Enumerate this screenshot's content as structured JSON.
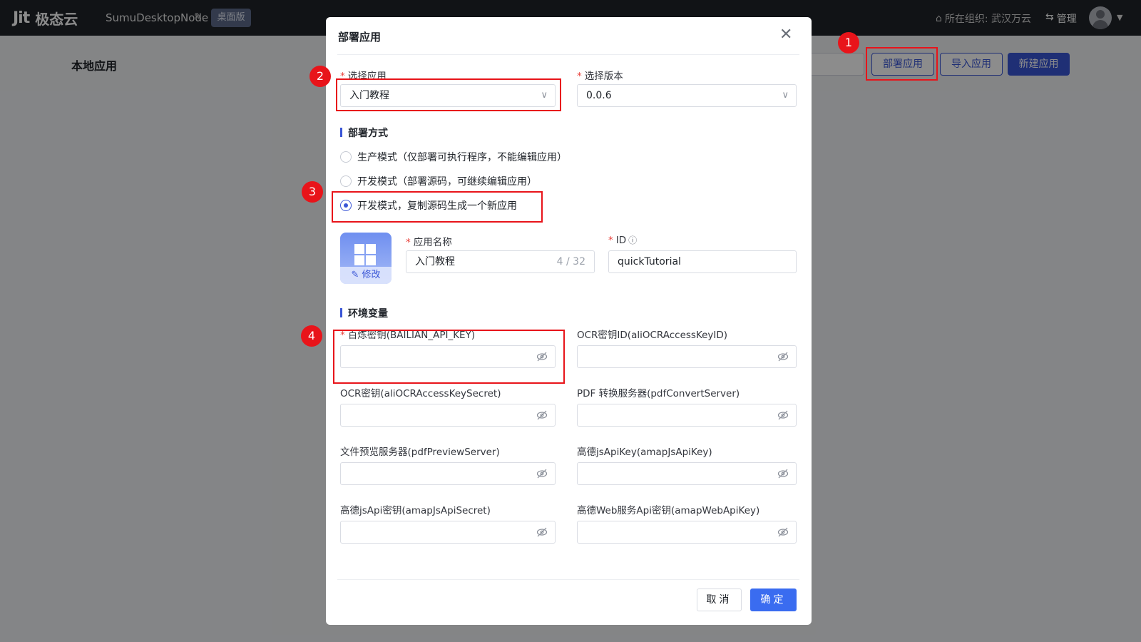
{
  "topbar": {
    "logo_mark": "Jit",
    "logo_text": "极态云",
    "node_name": "SumuDesktopNode",
    "badge": "桌面版",
    "org_label": "所在组织: 武汉万云",
    "manage": "管理"
  },
  "page": {
    "title": "本地应用",
    "buttons": {
      "deploy": "部署应用",
      "import": "导入应用",
      "new": "新建应用"
    }
  },
  "modal": {
    "title": "部署应用",
    "select_app": {
      "label": "选择应用",
      "value": "入门教程"
    },
    "select_version": {
      "label": "选择版本",
      "value": "0.0.6"
    },
    "deploy_section": "部署方式",
    "modes": [
      {
        "label": "生产模式（仅部署可执行程序，不能编辑应用）",
        "checked": false
      },
      {
        "label": "开发模式（部署源码，可继续编辑应用）",
        "checked": false
      },
      {
        "label": "开发模式，复制源码生成一个新应用",
        "checked": true
      }
    ],
    "icon_edit": "修改",
    "app_name": {
      "label": "应用名称",
      "value": "入门教程",
      "counter": "4 / 32"
    },
    "app_id": {
      "label": "ID",
      "value": "quickTutorial"
    },
    "env_section": "环境变量",
    "env": [
      {
        "label": "百炼密钥(BAILIAN_API_KEY)",
        "required": true
      },
      {
        "label": "OCR密钥ID(aliOCRAccessKeyID)",
        "required": false
      },
      {
        "label": "OCR密钥(aliOCRAccessKeySecret)",
        "required": false
      },
      {
        "label": "PDF 转换服务器(pdfConvertServer)",
        "required": false
      },
      {
        "label": "文件预览服务器(pdfPreviewServer)",
        "required": false
      },
      {
        "label": "高德jsApiKey(amapJsApiKey)",
        "required": false
      },
      {
        "label": "高德jsApi密钥(amapJsApiSecret)",
        "required": false
      },
      {
        "label": "高德Web服务Api密钥(amapWebApiKey)",
        "required": false
      }
    ],
    "cancel": "取消",
    "ok": "确定"
  },
  "annotations": [
    "1",
    "2",
    "3",
    "4"
  ],
  "colors": {
    "primary": "#3a56d6",
    "annotation": "#e8141a",
    "topbar": "#1f2329"
  }
}
